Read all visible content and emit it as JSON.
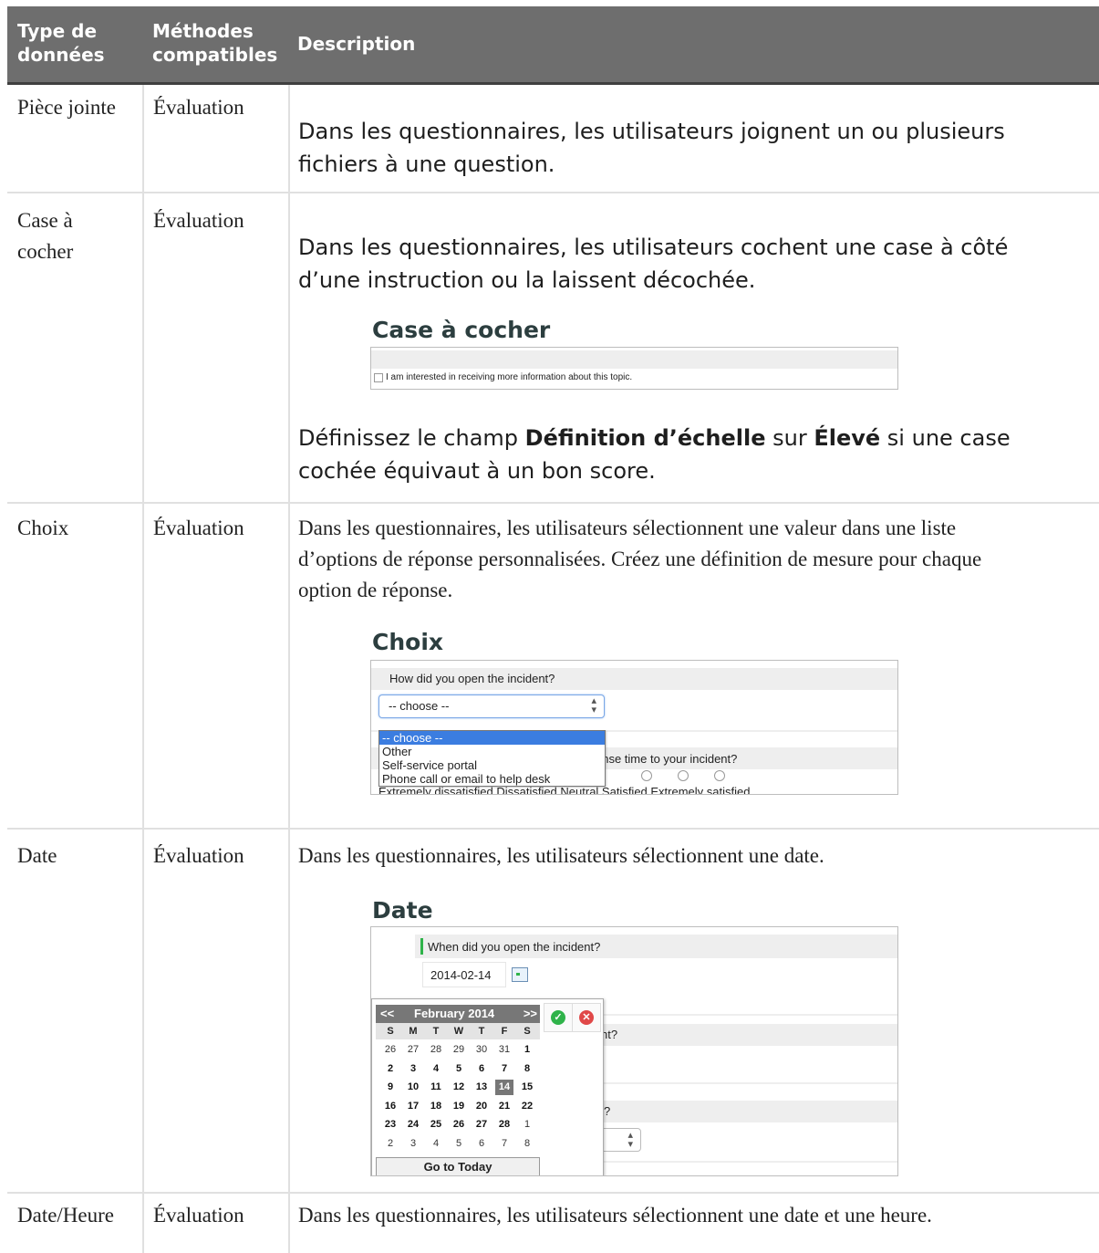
{
  "table": {
    "headers": {
      "type": [
        "Type de",
        "données"
      ],
      "methods": [
        "Méthodes",
        "compatibles"
      ],
      "description": "Description"
    },
    "rows": [
      {
        "type": "Pièce jointe",
        "method": "Évaluation",
        "description": [
          "Dans les questionnaires, les utilisateurs joignent un ou plusieurs",
          "fichiers à une question."
        ]
      },
      {
        "type": [
          "Case à",
          "cocher"
        ],
        "method": "Évaluation",
        "description": [
          "Dans les questionnaires, les utilisateurs cochent une case à côté",
          "d’une instruction ou la laissent décochée."
        ],
        "caption": "Case à cocher",
        "screenshot": {
          "checkbox_label": "I am interested in receiving more information about this topic."
        },
        "note": {
          "pre": "Définissez le champ ",
          "field": "Définition d’échelle",
          "mid": " sur ",
          "value": "Élevé",
          "post1": " si une case",
          "line2": "cochée équivaut à un bon score."
        }
      },
      {
        "type": "Choix",
        "method": "Évaluation",
        "description": [
          "Dans les questionnaires, les utilisateurs sélectionnent une valeur dans une liste",
          "d’options de réponse personnalisées. Créez une définition de mesure pour chaque",
          "option de réponse."
        ],
        "caption": "Choix",
        "screenshot": {
          "question": "How did you open the incident?",
          "select_value": "-- choose --",
          "options": [
            "-- choose --",
            "Other",
            "Self-service portal",
            "Phone call or email to help desk"
          ],
          "behind_question": "onse time to your incident?",
          "behind_scale": "Extremely dissatisfied  Dissatisfied  Neutral  Satisfied  Extremely satisfied"
        }
      },
      {
        "type": "Date",
        "method": "Évaluation",
        "description": [
          "Dans les questionnaires, les utilisateurs sélectionnent une date."
        ],
        "caption": "Date",
        "screenshot": {
          "question": "When did you open the incident?",
          "date_value": "2014-02-14",
          "prev": "<<",
          "month": "February 2014",
          "next": ">>",
          "weekdays": [
            "S",
            "M",
            "T",
            "W",
            "T",
            "F",
            "S"
          ],
          "weeks": [
            [
              "26",
              "27",
              "28",
              "29",
              "30",
              "31",
              "1"
            ],
            [
              "2",
              "3",
              "4",
              "5",
              "6",
              "7",
              "8"
            ],
            [
              "9",
              "10",
              "11",
              "12",
              "13",
              "14",
              "15"
            ],
            [
              "16",
              "17",
              "18",
              "19",
              "20",
              "21",
              "22"
            ],
            [
              "23",
              "24",
              "25",
              "26",
              "27",
              "28",
              "1"
            ],
            [
              "2",
              "3",
              "4",
              "5",
              "6",
              "7",
              "8"
            ]
          ],
          "selected_day": "14",
          "today_button": "Go to Today",
          "behind_1": "nt?",
          "behind_2": "?"
        }
      },
      {
        "type": "Date/Heure",
        "method": "Évaluation",
        "description": [
          "Dans les questionnaires, les utilisateurs sélectionnent une date et une heure."
        ]
      }
    ]
  },
  "colors": {
    "header_bg": "#6e6e6e",
    "caption": "#2c3e3f",
    "select_highlight": "#3b7de0",
    "accept": "#2fb34a",
    "cancel": "#e04848"
  }
}
